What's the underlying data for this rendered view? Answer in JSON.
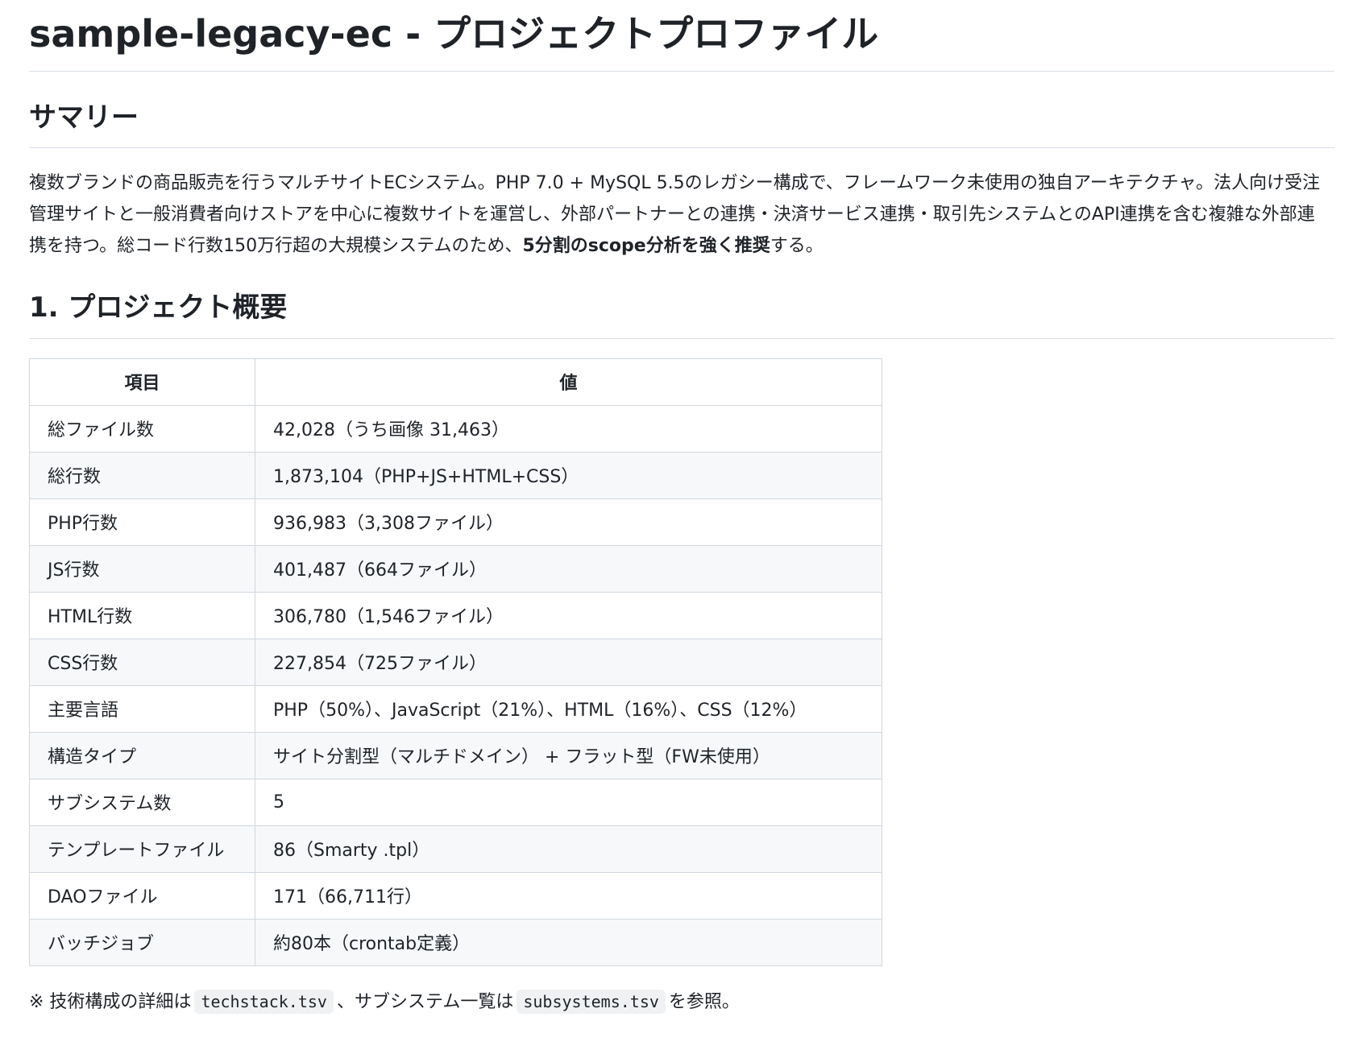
{
  "title": "sample-legacy-ec - プロジェクトプロファイル",
  "summary": {
    "heading": "サマリー",
    "text": "複数ブランドの商品販売を行うマルチサイトECシステム。PHP 7.0 + MySQL 5.5のレガシー構成で、フレームワーク未使用の独自アーキテクチャ。法人向け受注管理サイトと一般消費者向けストアを中心に複数サイトを運営し、外部パートナーとの連携・決済サービス連携・取引先システムとのAPI連携を含む複雑な外部連携を持つ。総コード行数150万行超の大規模システムのため、",
    "emphasis": "5分割のscope分析を強く推奨",
    "tail": "する。"
  },
  "overview": {
    "heading": "1. プロジェクト概要",
    "columns": [
      "項目",
      "値"
    ],
    "rows": [
      {
        "key": "総ファイル数",
        "value": "42,028（うち画像 31,463）"
      },
      {
        "key": "総行数",
        "value": "1,873,104（PHP+JS+HTML+CSS）"
      },
      {
        "key": "PHP行数",
        "value": "936,983（3,308ファイル）"
      },
      {
        "key": "JS行数",
        "value": "401,487（664ファイル）"
      },
      {
        "key": "HTML行数",
        "value": "306,780（1,546ファイル）"
      },
      {
        "key": "CSS行数",
        "value": "227,854（725ファイル）"
      },
      {
        "key": "主要言語",
        "value": "PHP（50%）、JavaScript（21%）、HTML（16%）、CSS（12%）"
      },
      {
        "key": "構造タイプ",
        "value": "サイト分割型（マルチドメイン） + フラット型（FW未使用）"
      },
      {
        "key": "サブシステム数",
        "value": "5"
      },
      {
        "key": "テンプレートファイル",
        "value": "86（Smarty .tpl）"
      },
      {
        "key": "DAOファイル",
        "value": "171（66,711行）"
      },
      {
        "key": "バッチジョブ",
        "value": "約80本（crontab定義）"
      }
    ]
  },
  "note": {
    "prefix": "※ 技術構成の詳細は",
    "file1": "techstack.tsv",
    "middle": "、サブシステム一覧は",
    "file2": "subsystems.tsv",
    "suffix": "を参照。"
  }
}
